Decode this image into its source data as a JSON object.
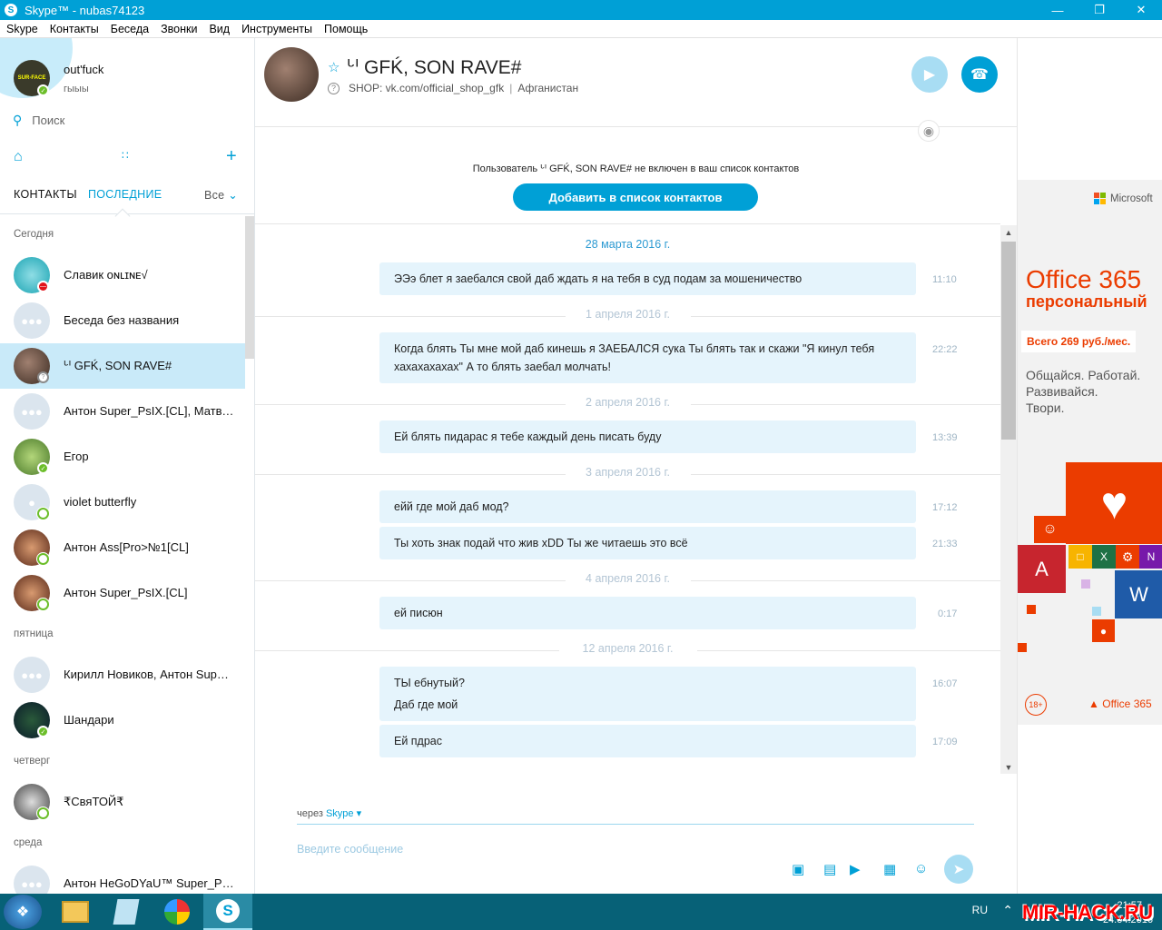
{
  "window": {
    "title": "Skype™ - nubas74123"
  },
  "menu": [
    "Skype",
    "Контакты",
    "Беседа",
    "Звонки",
    "Вид",
    "Инструменты",
    "Помощь"
  ],
  "profile": {
    "name": "out'fuck",
    "mood": "гыыы",
    "avatar_text": "SUR-FACE"
  },
  "search": {
    "placeholder": "Поиск"
  },
  "tabs": {
    "contacts": "КОНТАКТЫ",
    "recent": "ПОСЛЕДНИЕ",
    "filter": "Все"
  },
  "sections": {
    "today": "Сегодня",
    "friday": "пятница",
    "thursday": "четверг",
    "wednesday": "среда"
  },
  "contacts": [
    {
      "name": "Славик ᴏɴʟɪɴᴇ√",
      "status": "dnd"
    },
    {
      "name": "Беседа без названия",
      "status": "group"
    },
    {
      "name": "ᒡᑊ GFḰ, SON RAVE#",
      "status": "unknown"
    },
    {
      "name": "Антон Super_PsIX.[CL], Матвей…",
      "status": "group"
    },
    {
      "name": "Егор",
      "status": "online"
    },
    {
      "name": "violet butterfly",
      "status": "offline"
    },
    {
      "name": "Антон Ass[Pro>№1[CL]",
      "status": "offline"
    },
    {
      "name": "Антон Super_PsIX.[CL]",
      "status": "offline"
    },
    {
      "name": "Кирилл Новиков, Антон Supe…",
      "status": "group"
    },
    {
      "name": "Шандари",
      "status": "online"
    },
    {
      "name": "₹СвяТОЙ₹",
      "status": "offline"
    },
    {
      "name": "Антон HeGoDYaU™ Super_PsI…",
      "status": "group"
    }
  ],
  "conversation": {
    "name": "ᒡᑊ GFḰ, SON RAVE#",
    "mood": "SHOP: vk.com/official_shop_gfk",
    "location": "Афганистан",
    "not_in_contacts": "Пользователь ᒡᑊ GFḰ, SON RAVE# не включен в ваш список контактов",
    "add_button": "Добавить в список контактов"
  },
  "messages": [
    {
      "date": "28 марта 2016 г."
    },
    {
      "text": "ЭЭэ блет я заебался свой даб ждать я на тебя в суд подам за мошеничество",
      "time": "11:10"
    },
    {
      "date": "1 апреля 2016 г."
    },
    {
      "text": "Когда блять Ты мне мой даб кинешь я ЗАЕБАЛСЯ сука Ты блять так и скажи \"Я кинул тебя хахахахахах\"  А то блять заебал молчать!",
      "time": "22:22"
    },
    {
      "date": "2 апреля 2016 г."
    },
    {
      "text": "Ей блять пидарас я тебе каждый день писать буду",
      "time": "13:39"
    },
    {
      "date": "3 апреля 2016 г."
    },
    {
      "text": "ейй где мой даб мод?",
      "time": "17:12"
    },
    {
      "text": "Ты хоть знак подай что жив xDD Ты же читаешь это всё",
      "time": "21:33"
    },
    {
      "date": "4 апреля 2016 г."
    },
    {
      "text": "ей писюн",
      "time": "0:17"
    },
    {
      "date": "12 апреля 2016 г."
    },
    {
      "text": "ТЫ ебнутый?",
      "time": "16:07"
    },
    {
      "text": "Даб где мой",
      "time": ""
    },
    {
      "text": "Ей пдрас",
      "time": "17:09"
    }
  ],
  "compose": {
    "via": "через",
    "via_service": "Skype",
    "placeholder": "Введите сообщение"
  },
  "ad": {
    "brand": "Microsoft",
    "product": "Office 365",
    "edition": "персональный",
    "price": "Всего 269 руб./мес.",
    "slogan": [
      "Общайся. Работай.",
      "Развивайся.",
      "Твори."
    ],
    "age": "18+",
    "footer": "Office 365"
  },
  "taskbar": {
    "lang": "RU",
    "time": "21:57",
    "date": "24.04.2016"
  },
  "watermark": "MIR-HACK.RU",
  "colors": {
    "accent": "#00a0d6",
    "bubble": "#e5f4fc",
    "office": "#eb3c00"
  }
}
